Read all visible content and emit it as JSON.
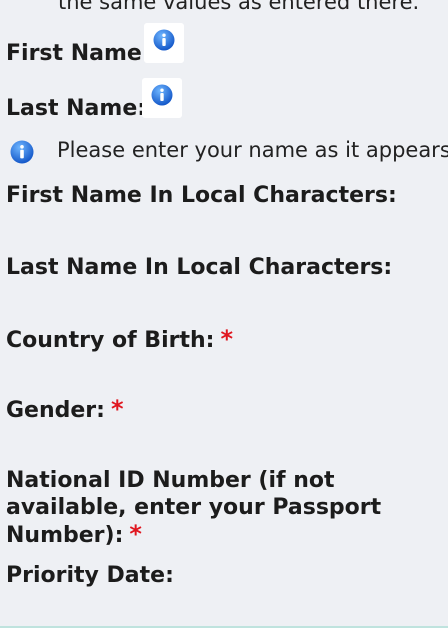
{
  "header_note": "the same values as entered there.",
  "fields": {
    "first_name": {
      "label": "First Name:"
    },
    "last_name": {
      "label": "Last Name:"
    },
    "name_note": "Please enter your name as it appears",
    "first_name_local": {
      "label": "First Name In Local Characters:"
    },
    "last_name_local": {
      "label": "Last Name In Local Characters:"
    },
    "country_of_birth": {
      "label": "Country of Birth:",
      "required_mark": "*"
    },
    "gender": {
      "label": "Gender:",
      "required_mark": "*"
    },
    "national_id": {
      "label": "National ID Number (if not available, enter your Passport Number):",
      "required_mark": "*"
    },
    "priority_date": {
      "label": "Priority Date:"
    }
  },
  "icons": {
    "info": "info-icon"
  },
  "colors": {
    "background": "#eef0f4",
    "required": "#e0161f",
    "info_blue": "#1e6fd9"
  }
}
